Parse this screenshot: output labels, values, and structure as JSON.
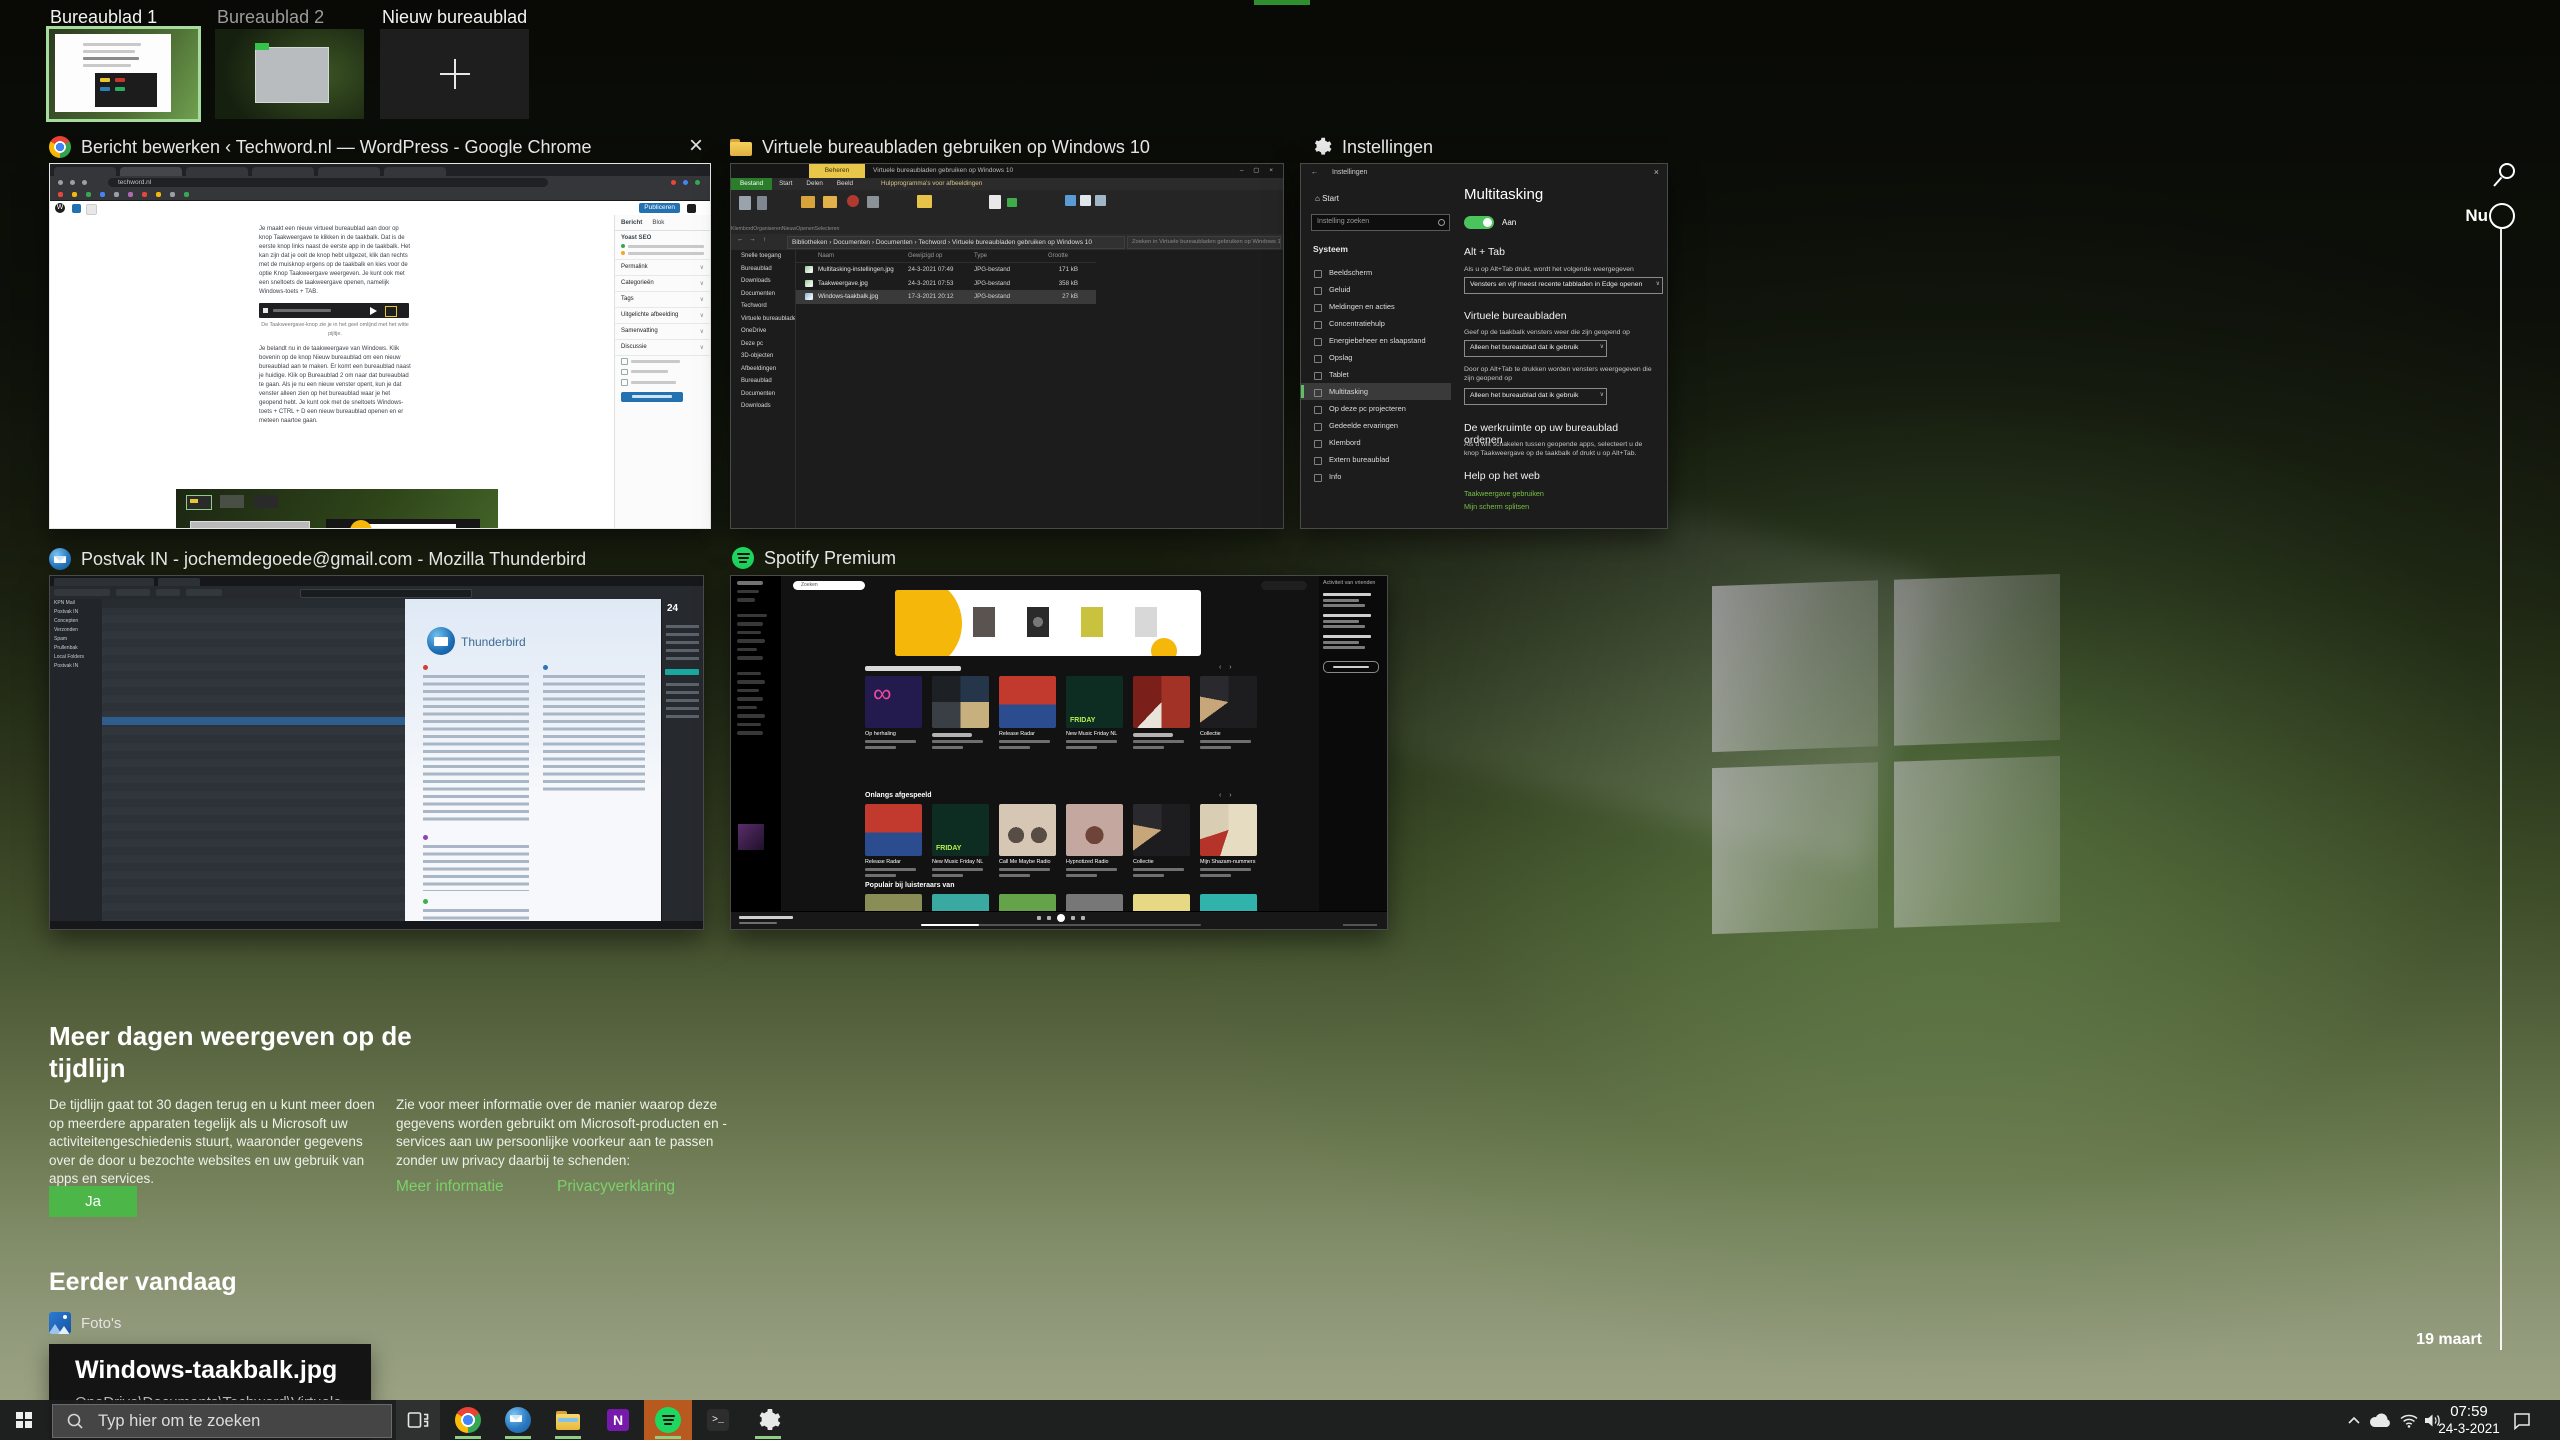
{
  "colors": {
    "accent": "#4cb748",
    "link_green": "#7bd169",
    "selection_border": "#a6dd9e",
    "taskbar_attention": "#b85a20",
    "toggle_green": "#4cc45e"
  },
  "desktops": {
    "items": [
      {
        "label": "Bureaublad 1"
      },
      {
        "label": "Bureaublad 2"
      },
      {
        "label": "Nieuw bureaublad"
      }
    ]
  },
  "chrome": {
    "title": "Bericht bewerken ‹ Techword.nl — WordPress - Google Chrome",
    "close": "×",
    "url": "techword.nl",
    "wp_logo": "W",
    "publish": "Publiceren",
    "sidebar_tabs": [
      "Bericht",
      "Blok"
    ],
    "yoast": "Yoast SEO",
    "sidebar_rows": [
      "Permalink",
      "Categorieën",
      "Tags",
      "Uitgelichte afbeelding",
      "Samenvatting",
      "Discussie"
    ],
    "p1": "Je maakt een nieuw virtueel bureaublad aan door op knop Taakweergave te klikken in de taakbalk. Dat is de eerste knop links naast de eerste app in de taakbalk. Het kan zijn dat je ooit de knop hebt uitgezet, klik dan rechts met de muisknop ergens op de taakbalk en kies voor de optie Knop Taakweergave weergeven. Je kunt ook met een sneltoets de taakweergave openen, namelijk Windows-toets + TAB.",
    "caption": "De Taakweergave-knop zie je in het geel omlijnd met het witte pijltje.",
    "p2": "Je belandt nu in de taakweergave van Windows. Klik bovenin op de knop Nieuw bureaublad om een nieuw bureaublad aan te maken. Er komt een bureaublad naast je huidige. Klik op Bureaublad 2 om naar dat bureaublad te gaan. Als je nu een nieuw venster opent, kun je dat venster alleen zien op het bureaublad waar je het geopend hebt. Je kunt ook met de sneltoets Windows-toets + CTRL + D een nieuw bureaublad openen en er meteen naartoe gaan."
  },
  "explorer": {
    "title": "Virtuele bureaubladen gebruiken op Windows 10",
    "manage_tab": "Beheren",
    "window_title": "Virtuele bureaubladen gebruiken op Windows 10",
    "controls": "– ▢ ×",
    "menu": [
      "Bestand",
      "Start",
      "Delen",
      "Beeld"
    ],
    "context_tab": "Hulpprogramma's voor afbeeldingen",
    "ribbon_groups": [
      "Klembord",
      "Organiseren",
      "Nieuw",
      "Openen",
      "Selecteren"
    ],
    "address": "Bibliotheken › Documenten › Documenten › Techword › Virtuele bureaubladen gebruiken op Windows 10",
    "search_placeholder": "Zoeken in Virtuele bureaubladen gebruiken op Windows 10",
    "columns": {
      "name": "Naam",
      "modified": "Gewijzigd op",
      "type": "Type",
      "size": "Grootte"
    },
    "files": [
      {
        "name": "Multitasking-instellingen.jpg",
        "modified": "24-3-2021 07:49",
        "type": "JPG-bestand",
        "size": "171 kB"
      },
      {
        "name": "Taakweergave.jpg",
        "modified": "24-3-2021 07:53",
        "type": "JPG-bestand",
        "size": "358 kB"
      },
      {
        "name": "Windows-taakbalk.jpg",
        "modified": "17-3-2021 20:12",
        "type": "JPG-bestand",
        "size": "27 kB"
      }
    ],
    "sidebar": [
      "Snelle toegang",
      "Bureaublad",
      "Downloads",
      "Documenten",
      "Techword",
      "Virtuele bureaublade…",
      "OneDrive",
      "Deze pc",
      "3D-objecten",
      "Afbeeldingen",
      "Bureaublad",
      "Documenten",
      "Downloads"
    ]
  },
  "settings": {
    "card_title": "Instellingen",
    "back_arrow": "←",
    "window_title": "Instellingen",
    "close": "×",
    "home": "Start",
    "search_placeholder": "Instelling zoeken",
    "group": "Systeem",
    "sidebar": [
      "Beeldscherm",
      "Geluid",
      "Meldingen en acties",
      "Concentratiehulp",
      "Energiebeheer en slaapstand",
      "Opslag",
      "Tablet",
      "Multitasking",
      "Op deze pc projecteren",
      "Gedeelde ervaringen",
      "Klembord",
      "Extern bureaublad",
      "Info"
    ],
    "page_title": "Multitasking",
    "toggle_label": "Aan",
    "alt_tab_heading": "Alt + Tab",
    "alt_tab_caption": "Als u op Alt+Tab drukt, wordt het volgende weergegeven",
    "alt_tab_value": "Vensters en vijf meest recente tabbladen in Edge openen",
    "vd_heading": "Virtuele bureaubladen",
    "vd_caption1": "Geef op de taakbalk vensters weer die zijn geopend op",
    "vd_value1": "Alleen het bureaublad dat ik gebruik",
    "vd_caption2": "Door op Alt+Tab te drukken worden vensters weergegeven die zijn geopend op",
    "vd_value2": "Alleen het bureaublad dat ik gebruik",
    "organize_heading": "De werkruimte op uw bureaublad ordenen",
    "organize_caption": "Als u wilt schakelen tussen geopende apps, selecteert u de knop Taakweergave op de taakbalk of drukt u op Alt+Tab.",
    "help_heading": "Help op het web",
    "links": [
      "Taakweergave gebruiken",
      "Mijn scherm splitsen"
    ]
  },
  "thunderbird": {
    "title": "Postvak IN - jochemdegoede@gmail.com - Mozilla Thunderbird",
    "brand": "Thunderbird",
    "agenda_day": "24",
    "folders": [
      "KPN Mail",
      "Postvak IN",
      "Concepten",
      "Verzonden",
      "Spam",
      "Prullenbak",
      "Local Folders",
      "Postvak IN"
    ]
  },
  "spotify": {
    "title": "Spotify Premium",
    "search": "Zoeken",
    "friends_heading": "Activiteit van vrienden",
    "section2": "Onlangs afgespeeld",
    "section3": "Populair bij luisteraars van",
    "row1": [
      {
        "label": "Op herhaling"
      },
      {
        "label": ""
      },
      {
        "label": "Release Radar"
      },
      {
        "label": "New Music Friday NL"
      },
      {
        "label": ""
      },
      {
        "label": "Collectie"
      }
    ],
    "row2": [
      {
        "label": "Release Radar"
      },
      {
        "label": "New Music Friday NL"
      },
      {
        "label": "Call Me Maybe Radio"
      },
      {
        "label": "Hypnotized Radio"
      },
      {
        "label": "Collectie"
      },
      {
        "label": "Mijn Shazam-nummers"
      }
    ]
  },
  "promo": {
    "heading": "Meer dagen weergeven op de tijdlijn",
    "left": "De tijdlijn gaat tot 30 dagen terug en u kunt meer doen op meerdere apparaten tegelijk als u Microsoft uw activiteitengeschiedenis stuurt, waaronder gegevens over de door u bezochte websites en uw gebruik van apps en services.",
    "right": "Zie voor meer informatie over de manier waarop deze gegevens worden gebruikt om Microsoft-producten en -services aan uw persoonlijke voorkeur aan te passen zonder uw privacy daarbij te schenden:",
    "link1": "Meer informatie",
    "link2": "Privacyverklaring",
    "yes": "Ja"
  },
  "earlier": {
    "heading": "Eerder vandaag",
    "app": "Foto's",
    "file": "Windows-taakbalk.jpg",
    "path": "OneDrive\\Documents\\Techword\\Virtuele"
  },
  "rail": {
    "now": "Nu",
    "date": "19 maart"
  },
  "taskbar": {
    "search_placeholder": "Typ hier om te zoeken",
    "time": "07:59",
    "date": "24-3-2021"
  }
}
